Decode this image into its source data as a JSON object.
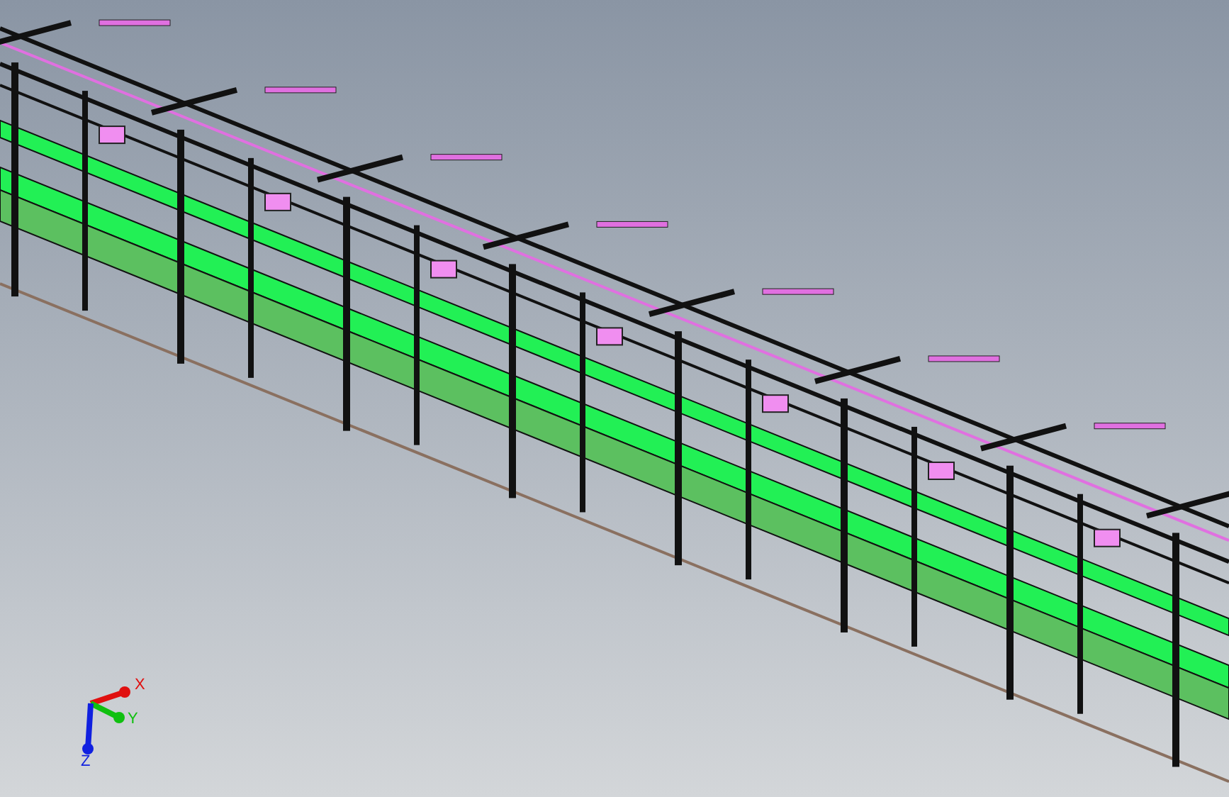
{
  "triad": {
    "axes": [
      {
        "label": "X",
        "color": "#e01010"
      },
      {
        "label": "Y",
        "color": "#10c010"
      },
      {
        "label": "Z",
        "color": "#1020e0"
      }
    ]
  }
}
